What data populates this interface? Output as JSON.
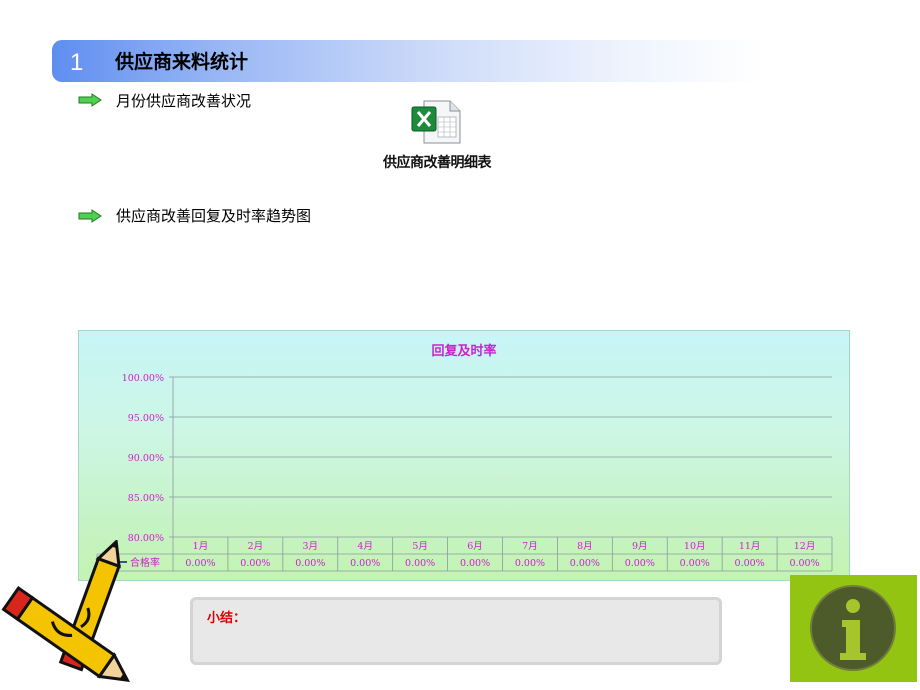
{
  "section": {
    "number": "1",
    "title": "供应商来料统计"
  },
  "bullets": [
    {
      "text": "月份供应商改善状况"
    },
    {
      "text": "供应商改善回复及时率趋势图"
    }
  ],
  "embedded_file": {
    "icon": "excel-file-icon",
    "label": "供应商改善明细表"
  },
  "chart_data": {
    "type": "line",
    "title": "回复及时率",
    "categories": [
      "1月",
      "2月",
      "3月",
      "4月",
      "5月",
      "6月",
      "7月",
      "8月",
      "9月",
      "10月",
      "11月",
      "12月"
    ],
    "y_ticks": [
      "100.00%",
      "95.00%",
      "90.00%",
      "85.00%",
      "80.00%"
    ],
    "ylim": [
      0.8,
      1.0
    ],
    "grid": true,
    "series": [
      {
        "name": "合格率",
        "values": [
          0,
          0,
          0,
          0,
          0,
          0,
          0,
          0,
          0,
          0,
          0,
          0
        ],
        "labels": [
          "0.00%",
          "0.00%",
          "0.00%",
          "0.00%",
          "0.00%",
          "0.00%",
          "0.00%",
          "0.00%",
          "0.00%",
          "0.00%",
          "0.00%",
          "0.00%"
        ]
      }
    ],
    "legend": "data-table",
    "colors": {
      "title": "#cc22cc",
      "axis_text": "#cc22cc",
      "series": "#1a1a7a",
      "grid": "#8a9aa0"
    }
  },
  "summary": {
    "label": "小结："
  },
  "colors": {
    "title_bar": "#5f8ef0",
    "bullet_arrow": "#3cb83c",
    "info_panel": "#92c411",
    "summary_label": "#e00000"
  },
  "icons": {
    "bullet": "green-arrow-icon",
    "info": "info-icon",
    "decoration": "pencils-clipart"
  }
}
